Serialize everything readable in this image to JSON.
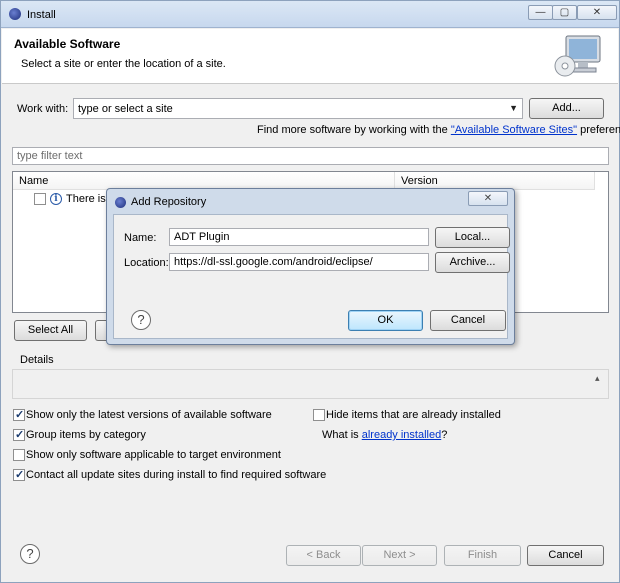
{
  "window": {
    "title": "Install",
    "controls": [
      "—",
      "▢",
      "✕"
    ]
  },
  "header": {
    "title": "Available Software",
    "subtitle": "Select a site or enter the location of a site."
  },
  "work_with": {
    "label": "Work with:",
    "value": "type or select a site",
    "add_button": "Add...",
    "more_prefix": "Find more software by working with the ",
    "more_link": "\"Available Software Sites\"",
    "more_suffix": " preferences."
  },
  "filter": {
    "placeholder": "type filter text"
  },
  "tree": {
    "columns": [
      "Name",
      "Version"
    ],
    "row_text": "There is n"
  },
  "buttons_row": {
    "select_all": "Select All"
  },
  "details": {
    "label": "Details"
  },
  "options": {
    "latest_versions": "Show only the latest versions of available software",
    "group_by_category": "Group items by category",
    "applicable_only": "Show only software applicable to target environment",
    "contact_sites": "Contact all update sites during install to find required software",
    "hide_installed": "Hide items that are already installed",
    "what_is_prefix": "What is ",
    "what_is_link": "already installed",
    "what_is_suffix": "?"
  },
  "footer": {
    "back": "< Back",
    "next": "Next >",
    "finish": "Finish",
    "cancel": "Cancel"
  },
  "dialog": {
    "title": "Add Repository",
    "close": "✕",
    "name_label": "Name:",
    "name_value": "ADT Plugin",
    "location_label": "Location:",
    "location_value": "https://dl-ssl.google.com/android/eclipse/",
    "local_button": "Local...",
    "archive_button": "Archive...",
    "ok": "OK",
    "cancel": "Cancel"
  }
}
